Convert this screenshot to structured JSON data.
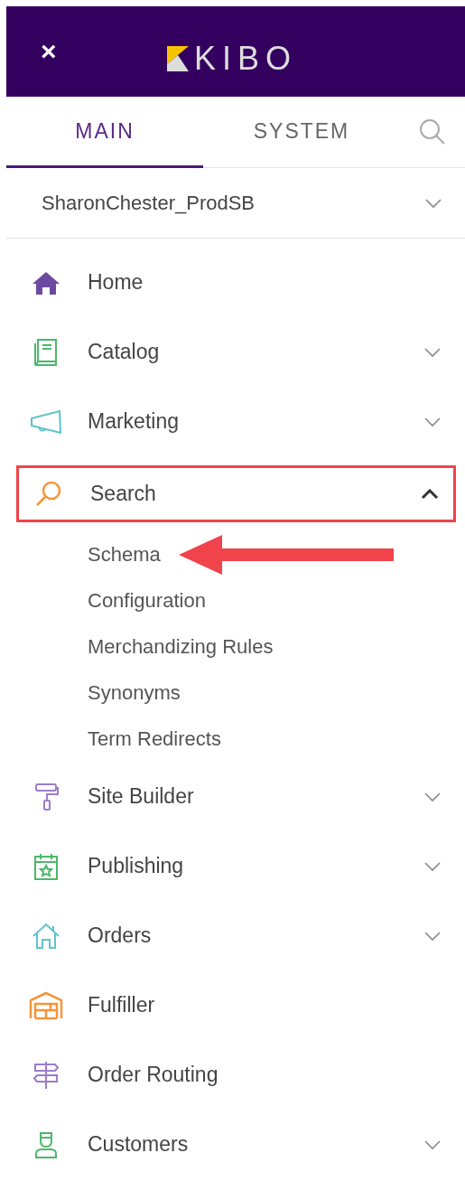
{
  "header": {
    "close": "×",
    "logo": "KIBO"
  },
  "tabs": [
    {
      "label": "MAIN",
      "selected": true
    },
    {
      "label": "SYSTEM",
      "selected": false
    }
  ],
  "tenant": {
    "value": "SharonChester_ProdSB"
  },
  "menu": [
    {
      "label": "Home",
      "expandable": false,
      "highlighted": false
    },
    {
      "label": "Catalog",
      "expandable": true,
      "expanded": false,
      "highlighted": false
    },
    {
      "label": "Marketing",
      "expandable": true,
      "expanded": false,
      "highlighted": false
    },
    {
      "label": "Search",
      "expandable": true,
      "expanded": true,
      "highlighted": true,
      "children": [
        {
          "label": "Schema",
          "pointed": true
        },
        {
          "label": "Configuration",
          "pointed": false
        },
        {
          "label": "Merchandizing Rules",
          "pointed": false
        },
        {
          "label": "Synonyms",
          "pointed": false
        },
        {
          "label": "Term Redirects",
          "pointed": false
        }
      ]
    },
    {
      "label": "Site Builder",
      "expandable": true,
      "expanded": false,
      "highlighted": false
    },
    {
      "label": "Publishing",
      "expandable": true,
      "expanded": false,
      "highlighted": false
    },
    {
      "label": "Orders",
      "expandable": true,
      "expanded": false,
      "highlighted": false
    },
    {
      "label": "Fulfiller",
      "expandable": false,
      "highlighted": false
    },
    {
      "label": "Order Routing",
      "expandable": false,
      "highlighted": false
    },
    {
      "label": "Customers",
      "expandable": true,
      "expanded": false,
      "highlighted": false
    }
  ]
}
